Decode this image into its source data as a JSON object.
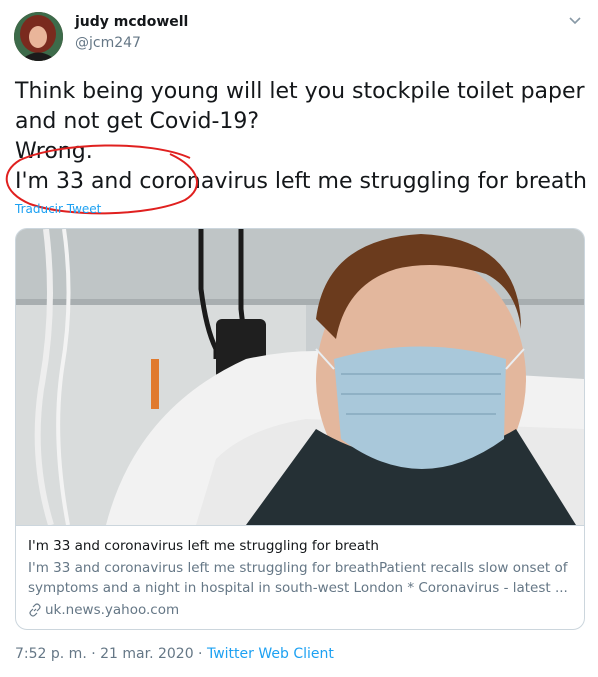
{
  "author": {
    "name": "judy mcdowell",
    "handle": "@jcm247"
  },
  "tweet": {
    "lines": [
      "Think being young will let you stockpile toilet paper",
      "and not get Covid-19?",
      "Wrong.",
      "I'm 33 and coronavirus left me struggling for breath"
    ],
    "translate_label": "Traducir Tweet"
  },
  "card": {
    "title": "I'm 33 and coronavirus left me struggling for breath",
    "description": "I'm 33 and coronavirus left me struggling for breathPatient recalls slow onset of symptoms and a night in hospital in south-west London * Coronavirus - latest ...",
    "domain": "uk.news.yahoo.com"
  },
  "footer": {
    "time": "7:52 p. m.",
    "separator1": " · ",
    "date": "21 mar. 2020",
    "separator2": " · ",
    "client": "Twitter Web Client"
  },
  "colors": {
    "link": "#1da1f2",
    "secondary_text": "#657786",
    "annotation": "#e0201f"
  },
  "icons": {
    "caret": "chevron-down-icon",
    "link": "link-icon"
  }
}
